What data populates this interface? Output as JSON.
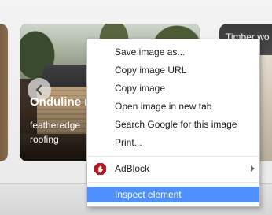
{
  "background": {
    "center_card": {
      "title": "Onduline r",
      "description": "featheredge roofing"
    },
    "right_card": {
      "title": "Timber wo"
    }
  },
  "context_menu": {
    "items": [
      {
        "label": "Save image as..."
      },
      {
        "label": "Copy image URL"
      },
      {
        "label": "Copy image"
      },
      {
        "label": "Open image in new tab"
      },
      {
        "label": "Search Google for this image"
      },
      {
        "label": "Print..."
      },
      {
        "label": "AdBlock",
        "icon": "adblock-icon",
        "has_submenu": true
      },
      {
        "label": "Inspect element",
        "highlighted": true
      }
    ],
    "highlight_color": "#4d90fe",
    "adblock_icon_color": "#c0101a"
  }
}
